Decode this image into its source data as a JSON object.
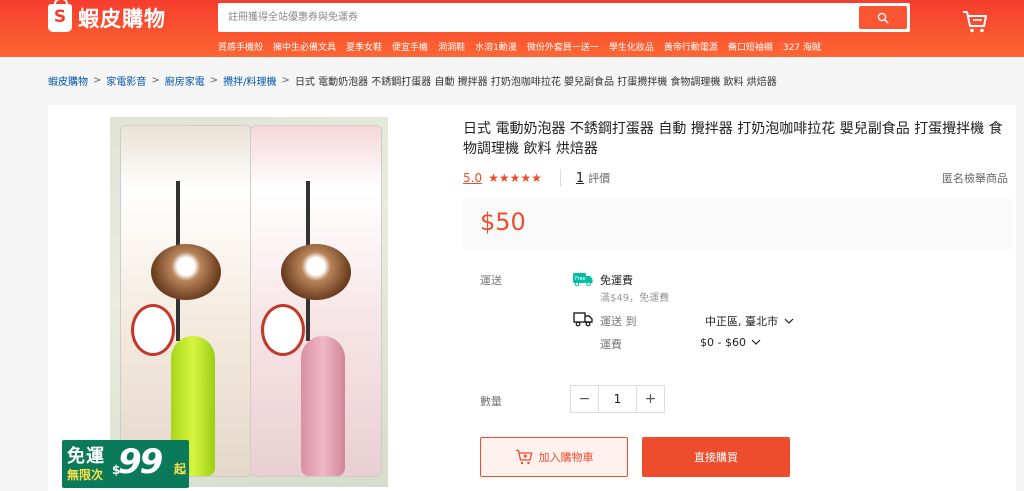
{
  "header": {
    "logo_text": "蝦皮購物",
    "logo_letter": "S",
    "search_placeholder": "註冊獲得全站優惠券與免運券",
    "hot_keywords": [
      "質感手機殼",
      "擁中生必備文具",
      "夏季女鞋",
      "便宜手機",
      "洞洞鞋",
      "水溶1動漫",
      "微份外套買一送一",
      "學生化妝品",
      "黃帝行動電源",
      "蕎口短袖襯",
      "327 海賊"
    ]
  },
  "breadcrumb": {
    "items": [
      "蝦皮購物",
      "家電影音",
      "廚房家電",
      "攪拌/料理機"
    ],
    "current": "日式 電動奶泡器 不銹鋼打蛋器 自動 攪拌器 打奶泡咖啡拉花 嬰兒副食品 打蛋攪拌機 食物調理機 飲料 烘焙器"
  },
  "product": {
    "title": "日式 電動奶泡器 不銹鋼打蛋器 自動 攪拌器 打奶泡咖啡拉花 嬰兒副食品 打蛋攪拌機 食物調理機 飲料 烘焙器",
    "rating": "5.0",
    "stars": "★★★★★",
    "review_count": "1",
    "review_label": "評價",
    "report_label": "匿名檢舉商品",
    "price": "$50",
    "image_badge": {
      "line1": "免運",
      "line2": "無限次",
      "dollar": "$",
      "number": "99",
      "suffix": "起"
    }
  },
  "shipping": {
    "label": "運送",
    "free_title": "免運費",
    "free_condition": "滿$49，免運費",
    "to_label": "運送 到",
    "location": "中正區, 臺北市",
    "fee_label": "運費",
    "fee_range": "$0 - $60"
  },
  "quantity": {
    "label": "數量",
    "value": "1",
    "minus": "−",
    "plus": "+"
  },
  "actions": {
    "add_to_cart": "加入購物車",
    "buy_now": "直接購買"
  },
  "colors": {
    "brand": "#ee4d2d",
    "link": "#0055aa",
    "badge_green": "#0b7a5a"
  }
}
